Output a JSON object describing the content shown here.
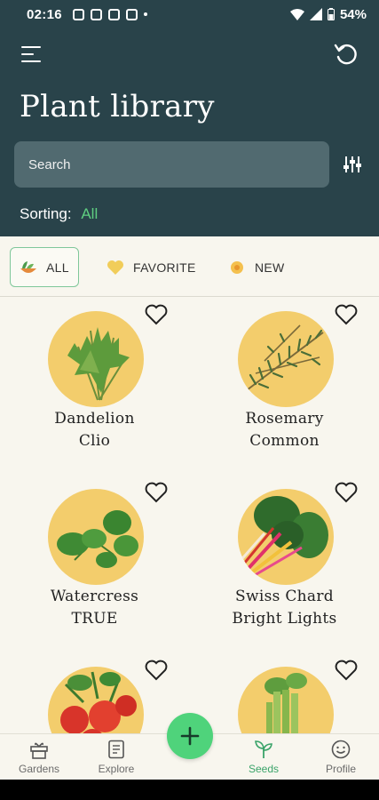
{
  "status_bar": {
    "time": "02:16",
    "battery": "54%"
  },
  "header": {
    "title": "Plant library",
    "search_placeholder": "Search",
    "sorting_label": "Sorting:",
    "sorting_value": "All"
  },
  "tabs": [
    {
      "label": "ALL",
      "active": true
    },
    {
      "label": "FAVORITE",
      "active": false
    },
    {
      "label": "NEW",
      "active": false
    }
  ],
  "plants": [
    {
      "name": "Dandelion",
      "variety": "Clio"
    },
    {
      "name": "Rosemary",
      "variety": "Common"
    },
    {
      "name": "Watercress",
      "variety": "TRUE"
    },
    {
      "name": "Swiss Chard",
      "variety": "Bright Lights"
    },
    {
      "name": "",
      "variety": ""
    },
    {
      "name": "",
      "variety": ""
    }
  ],
  "bottom_nav": [
    {
      "label": "Gardens",
      "icon": "gift-icon"
    },
    {
      "label": "Explore",
      "icon": "document-icon"
    },
    {
      "label": "Seeds",
      "icon": "sprout-icon",
      "active": true
    },
    {
      "label": "Profile",
      "icon": "smiley-icon"
    }
  ],
  "colors": {
    "header": "#29434a",
    "accent": "#4fd37b",
    "plate": "#f3cd6c",
    "background": "#f8f6ee"
  }
}
